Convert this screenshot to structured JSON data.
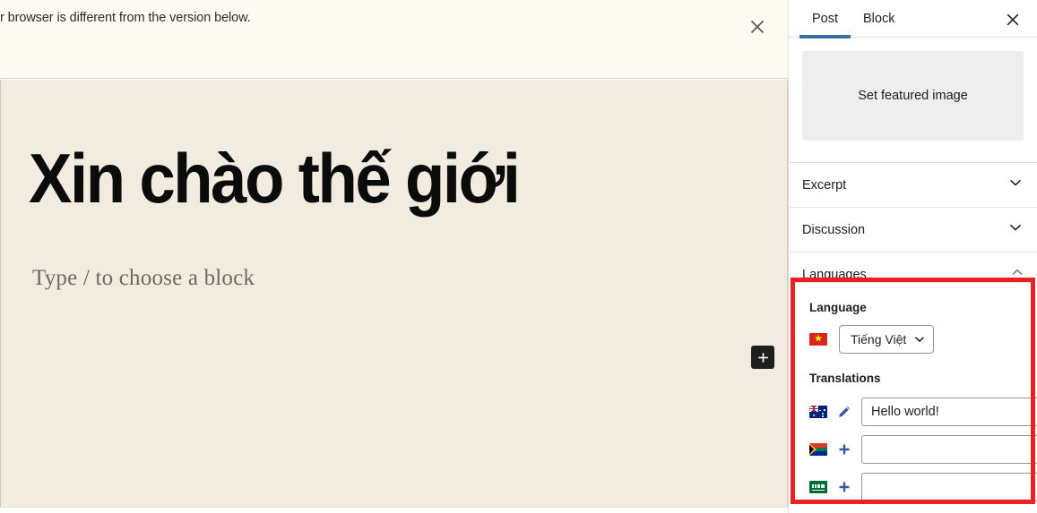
{
  "editor": {
    "notice": {
      "text": "r browser is different from the version below.",
      "close_label": "Dismiss this notice",
      "background": "#fdfaf1"
    },
    "post_title": "Xin chào thế giới",
    "block_placeholder": "Type / to choose a block",
    "add_block_label": "Add block",
    "canvas_background": "#f2ece0"
  },
  "sidebar": {
    "tabs": [
      {
        "label": "Post",
        "active": true
      },
      {
        "label": "Block",
        "active": false
      }
    ],
    "close_label": "Close settings",
    "featured_image": {
      "label": "Set featured image"
    },
    "panels": [
      {
        "label": "Excerpt",
        "expanded": false,
        "icon": "chevron-down-icon"
      },
      {
        "label": "Discussion",
        "expanded": false,
        "icon": "chevron-down-icon"
      },
      {
        "label": "Languages",
        "expanded": true,
        "icon": "chevron-up-icon"
      }
    ],
    "languages_panel": {
      "highlight_color": "#ed2024",
      "language_label": "Language",
      "language_flag": "vietnam-flag-icon",
      "language_value": "Tiếng Việt",
      "translations_label": "Translations",
      "translations": [
        {
          "flag": "australia-flag-icon",
          "action": "edit-pencil-icon",
          "action_label": "Edit translation",
          "value": "Hello world!",
          "placeholder": ""
        },
        {
          "flag": "south-africa-flag-icon",
          "action": "add-plus-icon",
          "action_label": "Add translation",
          "value": "",
          "placeholder": ""
        },
        {
          "flag": "saudi-arabia-flag-icon",
          "action": "add-plus-icon",
          "action_label": "Add translation",
          "value": "",
          "placeholder": ""
        }
      ]
    }
  }
}
